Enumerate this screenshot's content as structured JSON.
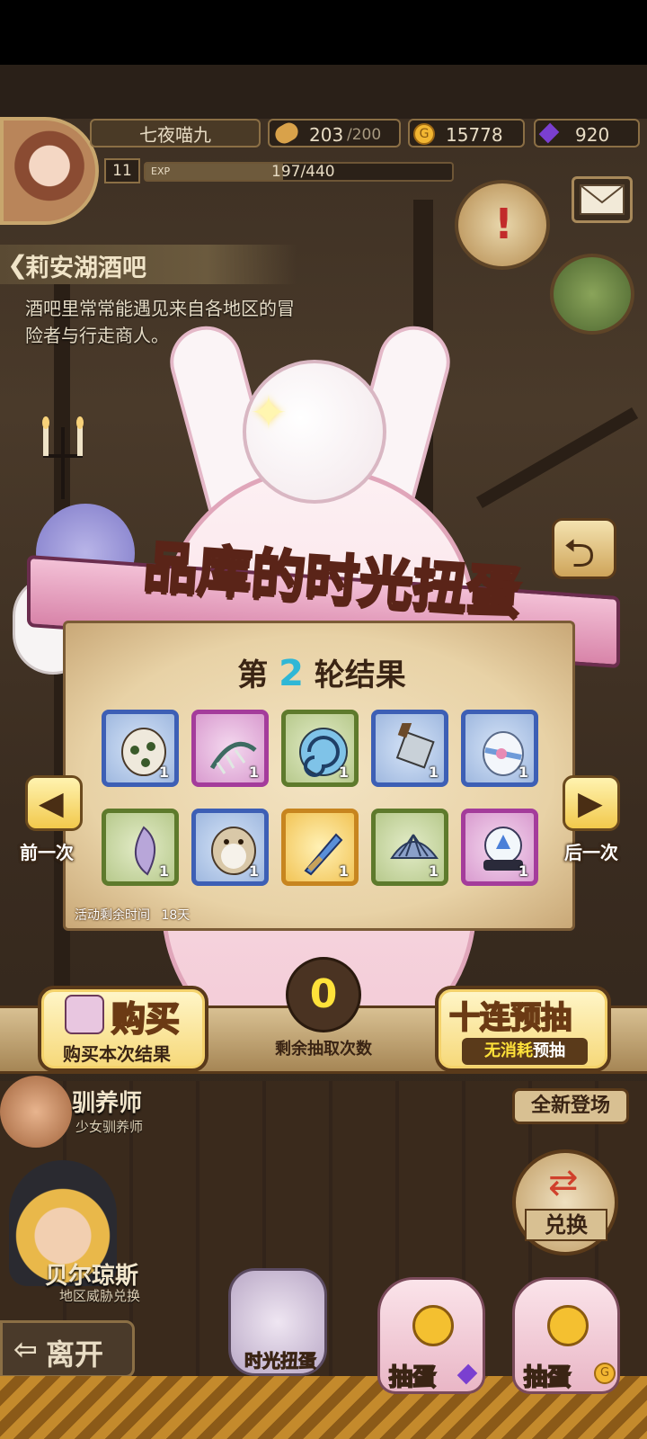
{
  "hud": {
    "player_name": "七夜喵九",
    "level": "11",
    "exp_label": "EXP",
    "exp_text": "197/440",
    "exp_fraction": 0.448,
    "stamina_current": "203",
    "stamina_max": "/200",
    "gold": "15778",
    "gems": "920"
  },
  "location": {
    "title": "莉安湖酒吧",
    "description_line1": "酒吧里常常能遇见来自各地区的冒",
    "description_line2": "险者与行走商人。"
  },
  "gacha": {
    "title": "品库的时光扭蛋",
    "round_prefix": "第",
    "round_number": "2",
    "round_suffix": "轮结果",
    "event_time_label": "活动剩余时间",
    "event_time_value": "18天",
    "prev_label": "前一次",
    "next_label": "后一次",
    "remaining_count": "0",
    "remaining_label": "剩余抽取次数",
    "buy_label": "购买",
    "buy_sub": "购买本次结果",
    "ten_label": "十连预抽",
    "ten_sub_a": "无消耗",
    "ten_sub_b": "预抽",
    "items": [
      {
        "icon": "skull-egg-icon",
        "rarity": "blue",
        "count": "1"
      },
      {
        "icon": "fossil-skeleton-icon",
        "rarity": "purple",
        "count": "1"
      },
      {
        "icon": "blue-shell-ball-icon",
        "rarity": "green",
        "count": "1"
      },
      {
        "icon": "cleaver-icon",
        "rarity": "blue",
        "count": "1"
      },
      {
        "icon": "ribbon-egg-icon",
        "rarity": "blue",
        "count": "1"
      },
      {
        "icon": "purple-flower-icon",
        "rarity": "green",
        "count": "1"
      },
      {
        "icon": "owl-doll-icon",
        "rarity": "blue",
        "count": "1"
      },
      {
        "icon": "sword-icon",
        "rarity": "gold",
        "count": "1"
      },
      {
        "icon": "clam-shell-icon",
        "rarity": "green",
        "count": "1"
      },
      {
        "icon": "crystal-orb-icon",
        "rarity": "purple",
        "count": "1"
      }
    ]
  },
  "side": {
    "new_arrival": "全新登场",
    "exchange": "兑换",
    "trainer_name": "驯养师",
    "trainer_sub": "少女驯养师",
    "bel_name": "贝尔琼斯",
    "bel_sub": "地区威胁兑换",
    "leave": "离开"
  },
  "bottom": {
    "time_gacha": "时光扭蛋",
    "draw_gem": "抽蛋",
    "draw_gold": "抽蛋"
  },
  "colors": {
    "accent_gold": "#f6d878",
    "ribbon_pink": "#e7a3c0",
    "title_purple": "#7a2fd6",
    "round_teal": "#2fb7d6",
    "counter_yellow": "#ffe23a"
  }
}
